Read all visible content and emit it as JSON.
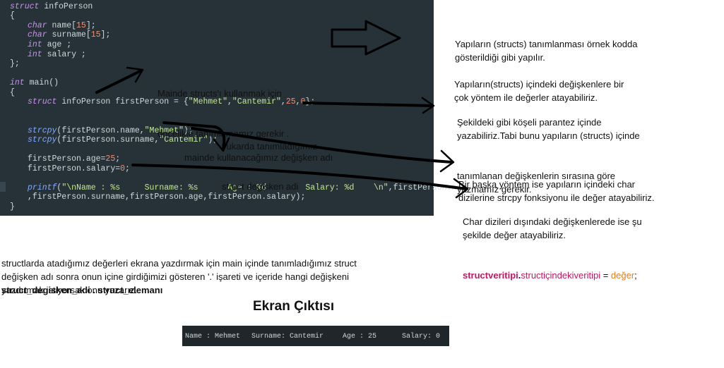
{
  "code": {
    "l1": {
      "kw": "struct",
      "rest": " infoPerson"
    },
    "l2": "{",
    "l3": {
      "kw": "char",
      "rest": " name[",
      "num": "15",
      "end": "];"
    },
    "l4": {
      "kw": "char",
      "rest": " surname[",
      "num": "15",
      "end": "];"
    },
    "l5": {
      "kw": "int",
      "rest": " age ;"
    },
    "l6": {
      "kw": "int",
      "rest": " salary ;"
    },
    "l7": "};",
    "l8": {
      "kw": "int",
      "rest": " main()"
    },
    "l9": "{",
    "l10": {
      "kw": "struct",
      "rest": " infoPerson firstPerson = {",
      "s1": "\"Mehmet\"",
      "c1": ",",
      "s2": "\"Cantemir\"",
      "c2": ",",
      "n1": "25",
      "c3": ",",
      "n2": "0",
      "end": "};"
    },
    "l11": {
      "fn": "strcpy",
      "rest": "(firstPerson.name,",
      "str": "\"Mehmet\"",
      "end": ");"
    },
    "l12": {
      "fn": "strcpy",
      "rest": "(firstPerson.surname,",
      "str": "\"Cantemir\"",
      "end": ");"
    },
    "l13": {
      "rest": "firstPerson.age=",
      "num": "25",
      "end": ";"
    },
    "l14": {
      "rest": "firstPerson.salary=",
      "num": "0",
      "end": ";"
    },
    "l15": {
      "fn": "printf",
      "rest": "(",
      "str": "\"\\nName : %s     Surname: %s      Age : %d        Salary: %d    \\n\"",
      "end": ",firstPerson.name"
    },
    "l16": ",firstPerson.surname,firstPerson.age,firstPerson.salary);",
    "l17": "}"
  },
  "annotations": {
    "main_note": [
      "Mainde structs'ı kullanmak için",
      "öncelikle tanımlamamız gerekir ."
    ],
    "struct_var_note": [
      "yukarda tanımladığımız",
      "struct degisken adi"
    ],
    "var_name_note": "mainde kullanacağımız değişken adı"
  },
  "right_notes": {
    "p1": [
      "Yapıların (structs) tanımlanması örnek kodda",
      "gösterildiği gibi yapılır."
    ],
    "p2": [
      "Yapıların(structs) içindeki değişkenlere bir",
      "çok yöntem ile değerler atayabiliriz."
    ],
    "p3": [
      "Şekildeki gibi köşeli parantez içinde",
      "yazabiliriz.Tabi bunu yapıların (structs) içinde",
      "tanımlanan değişkenlerin sırasına göre",
      "yazmamız gerekir."
    ],
    "p4": [
      "Bir başka yöntem ise yapıların içindeki char",
      "dizilerine strcpy fonksiyonu ile değer atayabiliriz."
    ],
    "p5": [
      "Char dizileri dışındaki değişkenlerede ise şu",
      "şekilde değer atayabiliriz."
    ],
    "formula": {
      "part1": "structveritipi",
      "dot": ".",
      "part2": "structiçindekiveritipi",
      "eq": " = ",
      "part3": "değer",
      "end": ";"
    }
  },
  "bottom": {
    "lines": [
      "structlarda atadığımız değerleri ekrana yazdırmak için main içinde tanımladığımız struct",
      "değişken adı sonra onun içine girdiğimizi gösteren '.' işareti ve içeride hangi değişkeni",
      "yazdırmak istiyorsak onu yazarız."
    ],
    "syntax": "struct_degisken_adi . struct_elemanı"
  },
  "output": {
    "title": "Ekran Çıktısı",
    "name": "Name : Mehmet",
    "surname": "Surname: Cantemir",
    "age": "Age : 25",
    "salary": "Salary: 0"
  }
}
